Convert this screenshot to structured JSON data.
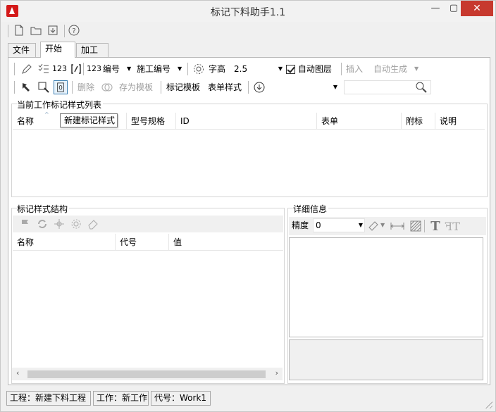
{
  "window": {
    "title": "标记下料助手1.1",
    "min": "—",
    "max": "▢",
    "close": "✕"
  },
  "top_toolbar": {
    "icons": [
      "new-file-icon",
      "open-folder-icon",
      "save-icon",
      "help-icon"
    ],
    "help_glyph": "?"
  },
  "tabs": [
    {
      "label": "文件",
      "active": false
    },
    {
      "label": "开始",
      "active": true
    },
    {
      "label": "加工图",
      "active": false
    }
  ],
  "ribbon_row1": {
    "number_label": "123",
    "numbering_label": "编号",
    "construction_numbering_label": "施工编号",
    "font_height_label": "字高",
    "font_height_value": "2.5",
    "auto_layer_label": "自动图层",
    "auto_layer_checked": true,
    "insert_label": "插入",
    "auto_generate_label": "自动生成"
  },
  "ribbon_row2": {
    "delete_label": "删除",
    "save_template_label": "存为模板",
    "mark_template_label": "标记模板",
    "form_style_label": "表单样式",
    "template_select_value": "",
    "search_value": ""
  },
  "current_styles": {
    "group_title": "当前工作标记样式列表",
    "columns": [
      "名称",
      "型号规格",
      "ID",
      "表单",
      "附标",
      "说明"
    ],
    "rows": []
  },
  "tooltip": {
    "text": "新建标记样式"
  },
  "structure": {
    "group_title": "标记样式结构",
    "columns": [
      "名称",
      "代号",
      "值"
    ],
    "rows": []
  },
  "details": {
    "group_title": "详细信息",
    "precision_label": "精度",
    "precision_value": "0"
  },
  "status": {
    "project": "工程：新建下料工程",
    "work": "工作：新工作",
    "code": "代号：Work1"
  },
  "colors": {
    "accent_red": "#d41a1a",
    "close_red": "#c7392e",
    "border": "#b9b9b9"
  }
}
